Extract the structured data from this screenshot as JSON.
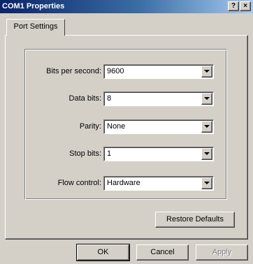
{
  "window": {
    "title": "COM1 Properties",
    "help_label": "?",
    "close_label": "×"
  },
  "tabs": [
    {
      "label": "Port Settings"
    }
  ],
  "settings": {
    "bits_per_second": {
      "label": "Bits per second:",
      "value": "9600"
    },
    "data_bits": {
      "label": "Data bits:",
      "value": "8"
    },
    "parity": {
      "label": "Parity:",
      "value": "None"
    },
    "stop_bits": {
      "label": "Stop bits:",
      "value": "1"
    },
    "flow_control": {
      "label": "Flow control:",
      "value": "Hardware"
    }
  },
  "buttons": {
    "restore_defaults": "Restore Defaults",
    "ok": "OK",
    "cancel": "Cancel",
    "apply": "Apply"
  }
}
